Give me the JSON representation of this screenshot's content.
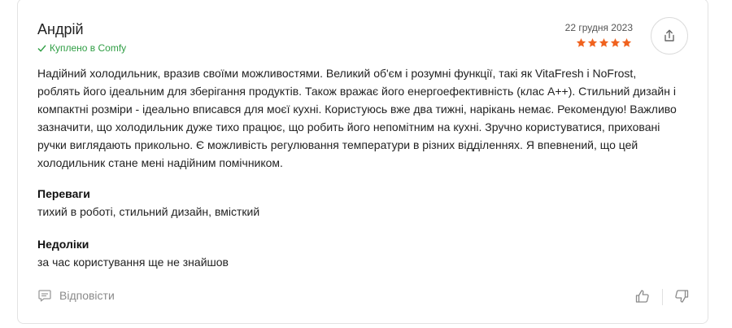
{
  "review": {
    "author": "Андрій",
    "purchase_badge": "Куплено в Comfy",
    "date": "22 грудня 2023",
    "rating": 5,
    "rating_max": 5,
    "star_color": "#f0621e",
    "text": "Надійний холодильник, вразив своїми можливостями. Великий об'єм і розумні функції, такі як VitaFresh і NoFrost, роблять його ідеальним для зберігання продуктів. Також вражає його енергоефективність (клас A++). Стильний дизайн і компактні розміри - ідеально вписався для моєї кухні. Користуюсь вже два тижні, нарікань немає. Рекомендую! Важливо зазначити, що холодильник дуже тихо працює, що робить його непомітним на кухні. Зручно користуватися, приховані ручки виглядають прикольно. Є можливість регулювання температури в різних відділеннях. Я впевнений, що цей холодильник стане мені надійним помічником.",
    "pros_title": "Переваги",
    "pros_text": "тихий в роботі, стильний дизайн, вмісткий",
    "cons_title": "Недоліки",
    "cons_text": "за час користування ще не знайшов"
  },
  "actions": {
    "reply_label": "Відповісти",
    "icons": [
      "share-icon",
      "comment-icon",
      "thumbs-up-icon",
      "thumbs-down-icon",
      "check-icon",
      "star-icon"
    ]
  },
  "colors": {
    "accent_green": "#2f9e44",
    "muted_text": "#8a8a8a"
  }
}
